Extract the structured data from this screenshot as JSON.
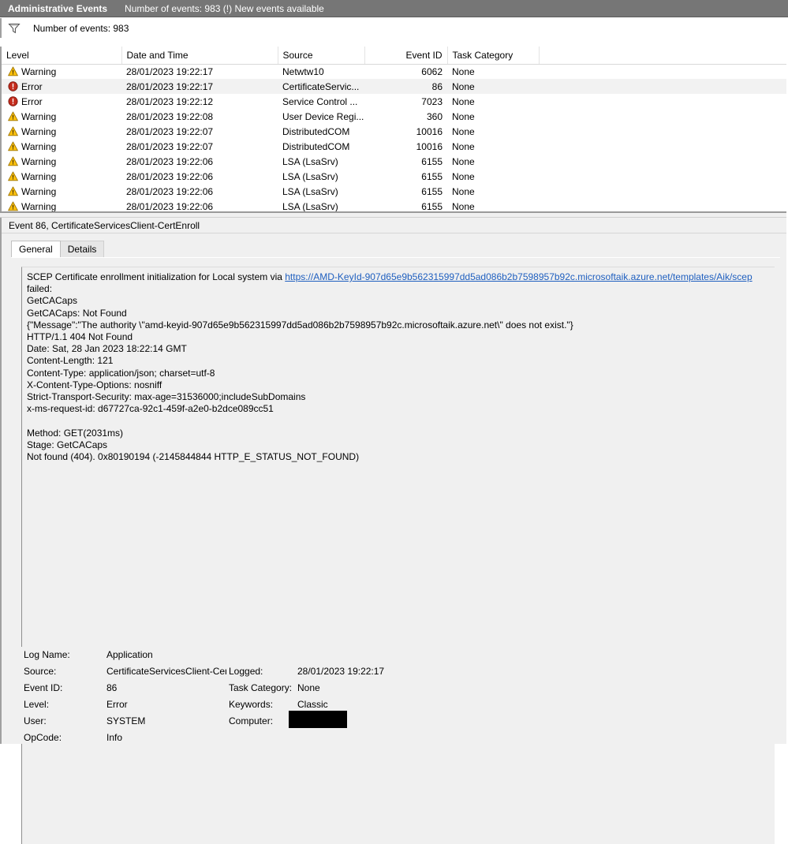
{
  "titlebar": {
    "pane_title": "Administrative Events",
    "pane_subtitle": "Number of events: 983 (!) New events available"
  },
  "filterbar": {
    "icon": "filter-funnel-icon",
    "text": "Number of events: 983"
  },
  "events_table": {
    "columns": [
      "Level",
      "Date and Time",
      "Source",
      "Event ID",
      "Task Category"
    ],
    "rows": [
      {
        "level": "Warning",
        "icon": "warning-icon",
        "date": "28/01/2023 19:22:17",
        "source": "Netwtw10",
        "event_id": "6062",
        "task_category": "None",
        "selected": false
      },
      {
        "level": "Error",
        "icon": "error-icon",
        "date": "28/01/2023 19:22:17",
        "source": "CertificateServic...",
        "event_id": "86",
        "task_category": "None",
        "selected": true
      },
      {
        "level": "Error",
        "icon": "error-icon",
        "date": "28/01/2023 19:22:12",
        "source": "Service Control ...",
        "event_id": "7023",
        "task_category": "None",
        "selected": false
      },
      {
        "level": "Warning",
        "icon": "warning-icon",
        "date": "28/01/2023 19:22:08",
        "source": "User Device Regi...",
        "event_id": "360",
        "task_category": "None",
        "selected": false
      },
      {
        "level": "Warning",
        "icon": "warning-icon",
        "date": "28/01/2023 19:22:07",
        "source": "DistributedCOM",
        "event_id": "10016",
        "task_category": "None",
        "selected": false
      },
      {
        "level": "Warning",
        "icon": "warning-icon",
        "date": "28/01/2023 19:22:07",
        "source": "DistributedCOM",
        "event_id": "10016",
        "task_category": "None",
        "selected": false
      },
      {
        "level": "Warning",
        "icon": "warning-icon",
        "date": "28/01/2023 19:22:06",
        "source": "LSA (LsaSrv)",
        "event_id": "6155",
        "task_category": "None",
        "selected": false
      },
      {
        "level": "Warning",
        "icon": "warning-icon",
        "date": "28/01/2023 19:22:06",
        "source": "LSA (LsaSrv)",
        "event_id": "6155",
        "task_category": "None",
        "selected": false
      },
      {
        "level": "Warning",
        "icon": "warning-icon",
        "date": "28/01/2023 19:22:06",
        "source": "LSA (LsaSrv)",
        "event_id": "6155",
        "task_category": "None",
        "selected": false
      },
      {
        "level": "Warning",
        "icon": "warning-icon",
        "date": "28/01/2023 19:22:06",
        "source": "LSA (LsaSrv)",
        "event_id": "6155",
        "task_category": "None",
        "selected": false
      }
    ]
  },
  "detail": {
    "header": "Event 86, CertificateServicesClient-CertEnroll",
    "tabs": [
      {
        "label": "General",
        "active": true
      },
      {
        "label": "Details",
        "active": false
      }
    ],
    "message": {
      "prefix": "SCEP Certificate enrollment initialization for Local system via ",
      "link": "https://AMD-KeyId-907d65e9b562315997dd5ad086b2b7598957b92c.microsoftaik.azure.net/templates/Aik/scep",
      "suffix": " failed:",
      "body": "\nGetCACaps\nGetCACaps: Not Found\n{\"Message\":\"The authority \\\"amd-keyid-907d65e9b562315997dd5ad086b2b7598957b92c.microsoftaik.azure.net\\\" does not exist.\"}\nHTTP/1.1 404 Not Found\nDate: Sat, 28 Jan 2023 18:22:14 GMT\nContent-Length: 121\nContent-Type: application/json; charset=utf-8\nX-Content-Type-Options: nosniff\nStrict-Transport-Security: max-age=31536000;includeSubDomains\nx-ms-request-id: d67727ca-92c1-459f-a2e0-b2dce089cc51\n\nMethod: GET(2031ms)\nStage: GetCACaps\nNot found (404). 0x80190194 (-2145844844 HTTP_E_STATUS_NOT_FOUND)"
    },
    "meta": {
      "log_name_label": "Log Name:",
      "log_name_value": "Application",
      "source_label": "Source:",
      "source_value": "CertificateServicesClient-Cer",
      "event_id_label": "Event ID:",
      "event_id_value": "86",
      "level_label": "Level:",
      "level_value": "Error",
      "user_label": "User:",
      "user_value": "SYSTEM",
      "opcode_label": "OpCode:",
      "opcode_value": "Info",
      "logged_label": "Logged:",
      "logged_value": "28/01/2023 19:22:17",
      "task_category_label": "Task Category:",
      "task_category_value": "None",
      "keywords_label": "Keywords:",
      "keywords_value": "Classic",
      "computer_label": "Computer:",
      "computer_value": ""
    }
  },
  "colors": {
    "titlebar_bg": "#767676",
    "warning": "#ffc20e",
    "error": "#c42b1c",
    "link": "#1f5fbf",
    "selection": "#f2f2f2"
  }
}
